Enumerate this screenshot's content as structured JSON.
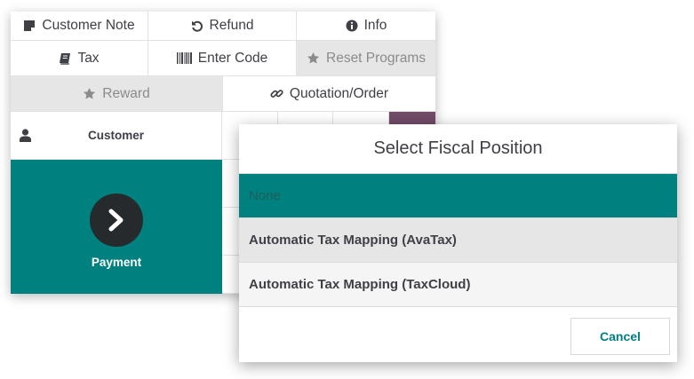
{
  "controls": {
    "row1": [
      {
        "label": "Customer Note",
        "icon": "sticky-note-icon"
      },
      {
        "label": "Refund",
        "icon": "undo-icon"
      },
      {
        "label": "Info",
        "icon": "info-circle-icon"
      }
    ],
    "row2": [
      {
        "label": "Tax",
        "icon": "book-icon"
      },
      {
        "label": "Enter Code",
        "icon": "barcode-icon"
      },
      {
        "label": "Reset Programs",
        "icon": "star-icon"
      }
    ],
    "row3": [
      {
        "label": "Reward",
        "icon": "star-icon"
      },
      {
        "label": "Quotation/Order",
        "icon": "link-icon"
      }
    ],
    "customer_label": "Customer",
    "payment_label": "Payment"
  },
  "dialog": {
    "title": "Select Fiscal Position",
    "options": [
      {
        "label": "None",
        "state": "selected"
      },
      {
        "label": "Automatic Tax Mapping (AvaTax)",
        "state": "hover"
      },
      {
        "label": "Automatic Tax Mapping (TaxCloud)",
        "state": "normal"
      }
    ],
    "cancel_label": "Cancel"
  },
  "colors": {
    "accent": "#00807e",
    "dark_button": "#262a2d",
    "purple": "#714b67",
    "disabled_bg": "#e6e6e6"
  }
}
